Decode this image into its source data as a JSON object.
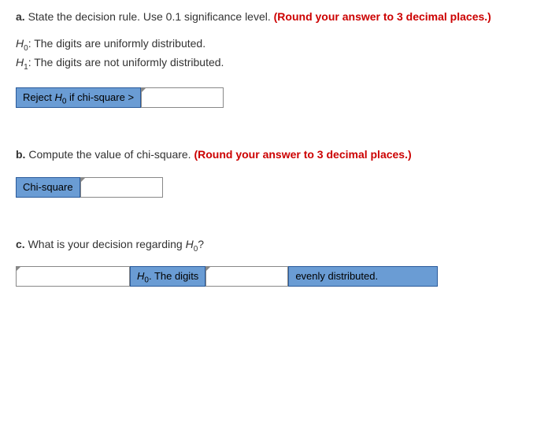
{
  "part_a": {
    "label": "a.",
    "prompt": "State the decision rule. Use 0.1 significance level.",
    "rounding": "(Round your answer to 3 decimal places.)",
    "h0_prefix": "H",
    "h0_sub": "0",
    "h0_text": ": The digits are uniformly distributed.",
    "h1_prefix": "H",
    "h1_sub": "1",
    "h1_text": ": The digits are not uniformly distributed.",
    "cell_prefix": "Reject ",
    "cell_h": "H",
    "cell_sub": "0",
    "cell_suffix": " if chi-square >",
    "input_value": ""
  },
  "part_b": {
    "label": "b.",
    "prompt": "Compute the value of chi-square.",
    "rounding": "(Round your answer to 3 decimal places.)",
    "cell_label": "Chi-square",
    "input_value": ""
  },
  "part_c": {
    "label": "c.",
    "prompt_prefix": "What is your decision regarding ",
    "prompt_h": "H",
    "prompt_sub": "0",
    "prompt_suffix": "?",
    "input1_value": "",
    "cell1_h": "H",
    "cell1_sub": "0",
    "cell1_suffix": ". The digits",
    "input2_value": "",
    "cell2_text": "evenly distributed."
  }
}
